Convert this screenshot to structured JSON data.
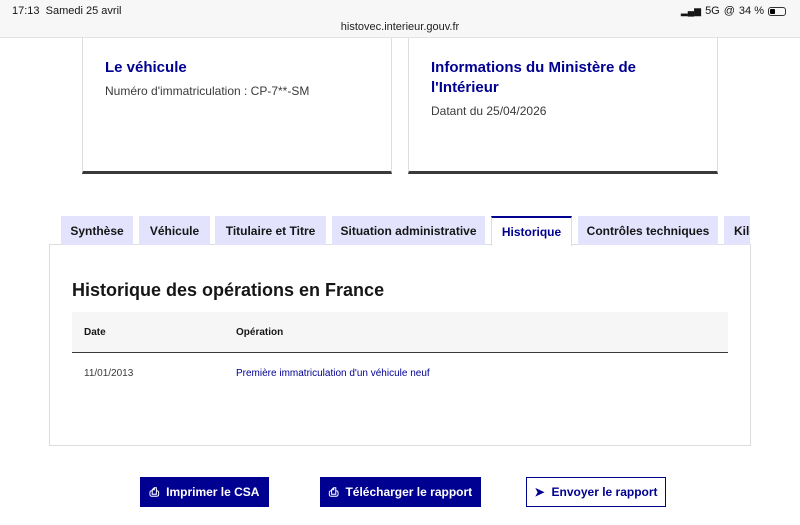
{
  "status": {
    "time": "17:13",
    "date": "Samedi 25 avril",
    "network": "5G",
    "battery": "34 %",
    "url": "histovec.interieur.gouv.fr"
  },
  "cards": [
    {
      "title": "Le véhicule",
      "text": "Numéro d'immatriculation : CP-7**-SM"
    },
    {
      "title": "Informations du Ministère de l'Intérieur",
      "text": "Datant du 25/04/2026"
    }
  ],
  "tabs": [
    "Synthèse",
    "Véhicule",
    "Titulaire et Titre",
    "Situation administrative",
    "Historique",
    "Contrôles techniques",
    "Kilométrage"
  ],
  "panel": {
    "title": "Historique des opérations en France",
    "headers": [
      "Date",
      "Opération"
    ],
    "rows": [
      {
        "date": "11/01/2013",
        "operation": "Première immatriculation d'un véhicule neuf"
      }
    ]
  },
  "buttons": {
    "print": "Imprimer le CSA",
    "download": "Télécharger le rapport",
    "send": "Envoyer le rapport"
  },
  "colors": {
    "accent": "#000091",
    "tab_bg": "#e3e3fd"
  }
}
